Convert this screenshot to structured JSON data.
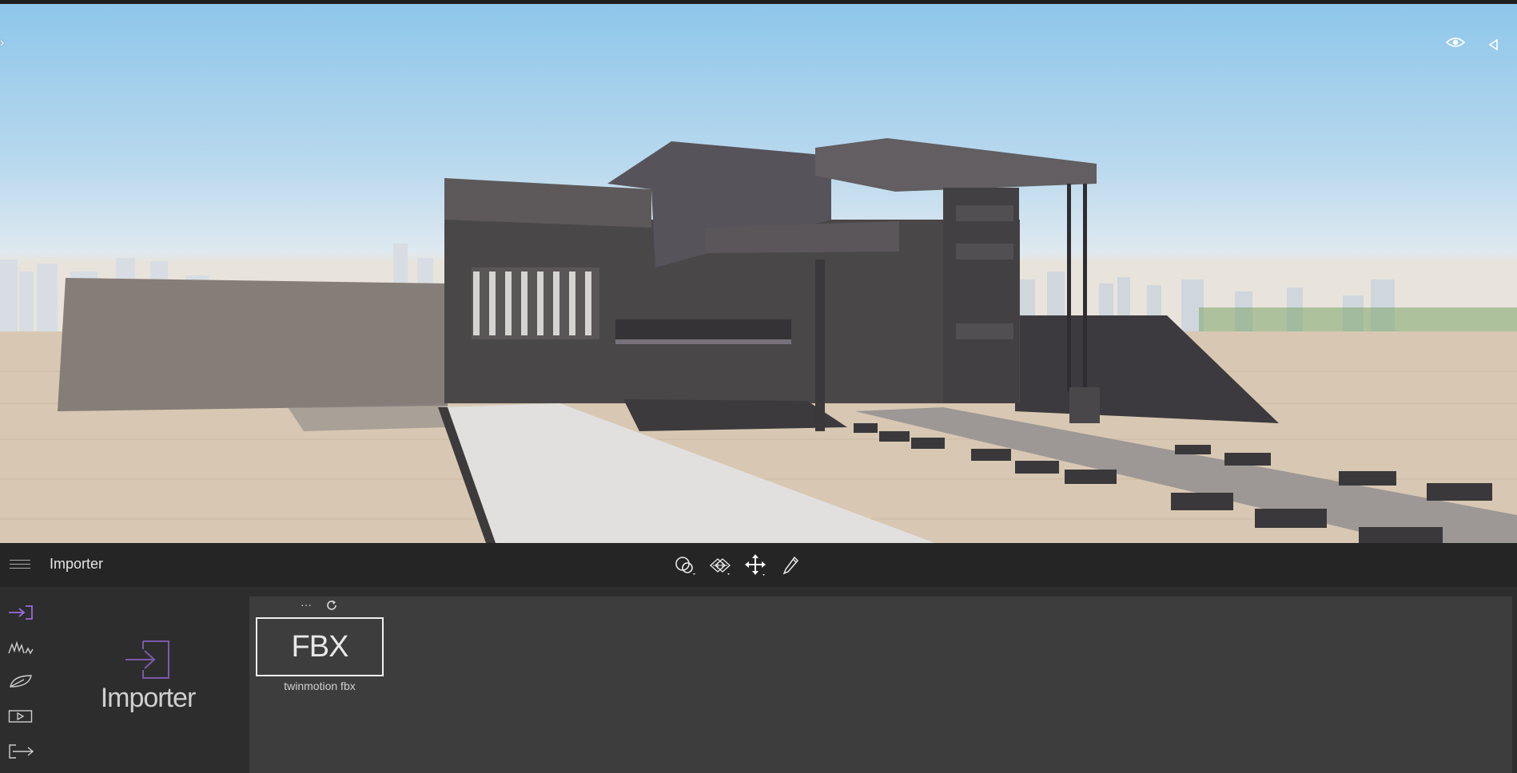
{
  "viewport": {
    "left_arrow_icon": "chevron-right-icon",
    "eye_icon": "eye-icon",
    "collapse_icon": "triangle-left-icon"
  },
  "toolbar": {
    "title": "Importer",
    "tools": [
      "select-tool-icon",
      "scatter-tool-icon",
      "move-tool-icon",
      "pipette-tool-icon"
    ]
  },
  "sidebar": {
    "title": "Importer",
    "items": [
      {
        "icon": "import-icon",
        "accent": "#8e5ec8"
      },
      {
        "icon": "terrain-icon"
      },
      {
        "icon": "leaf-icon"
      },
      {
        "icon": "media-icon"
      },
      {
        "icon": "export-icon"
      }
    ]
  },
  "library": {
    "more_label": "···",
    "refresh_icon": "refresh-icon",
    "items": [
      {
        "thumb_label": "FBX",
        "label": "twinmotion fbx"
      }
    ]
  }
}
